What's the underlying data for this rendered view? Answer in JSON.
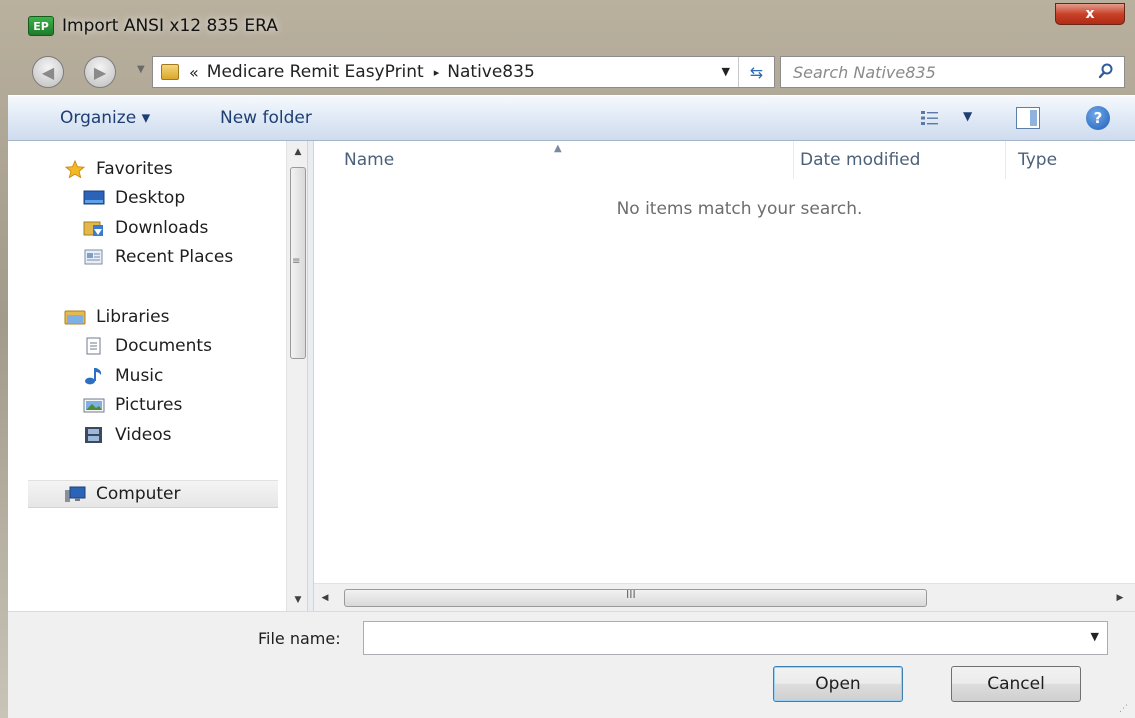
{
  "window": {
    "title": "Import ANSI x12 835 ERA",
    "app_icon_text": "EP",
    "close_label": "x"
  },
  "address": {
    "overflow_chevron": "«",
    "crumbs": [
      "Medicare Remit EasyPrint",
      "Native835"
    ],
    "separator": "▸"
  },
  "search": {
    "placeholder": "Search Native835"
  },
  "toolbar": {
    "organize_label": "Organize ▾",
    "new_folder_label": "New folder"
  },
  "nav": {
    "favorites_label": "Favorites",
    "favorites_items": [
      {
        "label": "Desktop",
        "icon": "desktop-icon"
      },
      {
        "label": "Downloads",
        "icon": "downloads-icon"
      },
      {
        "label": "Recent Places",
        "icon": "recent-places-icon"
      }
    ],
    "libraries_label": "Libraries",
    "libraries_items": [
      {
        "label": "Documents",
        "icon": "documents-icon"
      },
      {
        "label": "Music",
        "icon": "music-icon"
      },
      {
        "label": "Pictures",
        "icon": "pictures-icon"
      },
      {
        "label": "Videos",
        "icon": "videos-icon"
      }
    ],
    "computer_label": "Computer"
  },
  "file_list": {
    "columns": [
      "Name",
      "Date modified",
      "Type"
    ],
    "empty_message": "No items match your search."
  },
  "scrollbar": {
    "grip": "III"
  },
  "bottom": {
    "file_name_label": "File name:",
    "file_name_value": "",
    "open_label": "Open",
    "cancel_label": "Cancel"
  },
  "colors": {
    "command_bar": "#dee8f5",
    "command_text": "#1e3f73",
    "close_button": "#c8422a"
  }
}
